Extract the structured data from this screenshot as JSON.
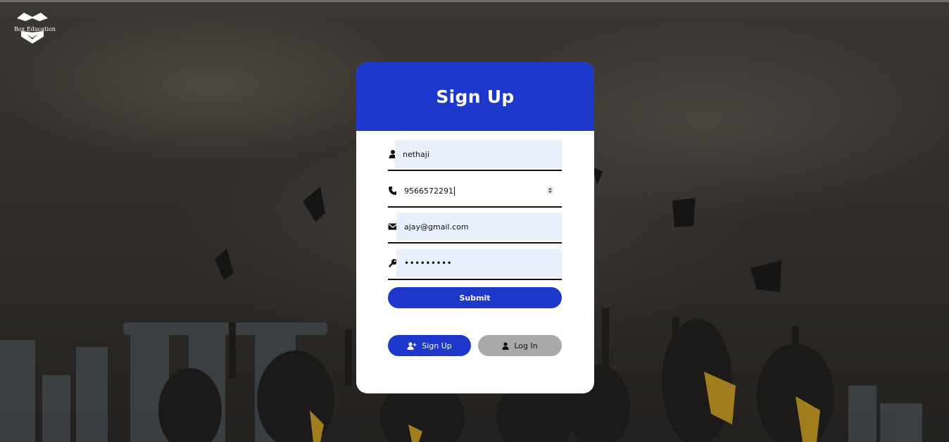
{
  "brand": {
    "logo_text": "Box Education"
  },
  "form": {
    "title": "Sign Up",
    "username": {
      "value": "nethaji",
      "icon": "user-icon"
    },
    "phone": {
      "value": "9566572291",
      "icon": "phone-icon"
    },
    "email": {
      "value": "ajay@gmail.com",
      "icon": "envelope-icon"
    },
    "password": {
      "value": "•••••••••",
      "icon": "key-icon"
    },
    "submit_label": "Submit"
  },
  "actions": {
    "signup_label": "Sign Up",
    "login_label": "Log In"
  },
  "colors": {
    "primary": "#1f38cc",
    "input_bg": "#e8effd",
    "secondary_button": "#a9a9a9"
  }
}
